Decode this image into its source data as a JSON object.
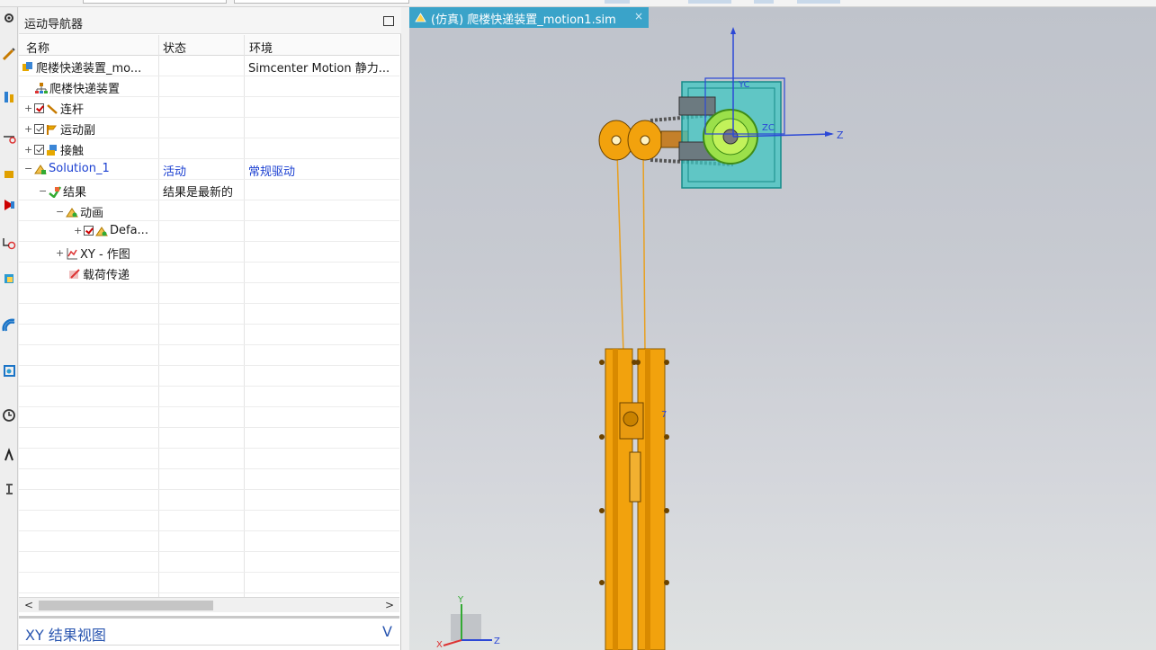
{
  "navigator": {
    "title": "运动导航器",
    "columns": [
      "名称",
      "状态",
      "环境"
    ],
    "rows": [
      {
        "name": "爬楼快递装置_mo...",
        "status": "",
        "env": "Simcenter Motion 静力..."
      },
      {
        "name": "爬楼快递装置",
        "status": "",
        "env": ""
      },
      {
        "name": "连杆",
        "status": "",
        "env": ""
      },
      {
        "name": "运动副",
        "status": "",
        "env": ""
      },
      {
        "name": "接触",
        "status": "",
        "env": ""
      },
      {
        "name": "Solution_1",
        "status": "活动",
        "env": "常规驱动"
      },
      {
        "name": "结果",
        "status": "结果是最新的",
        "env": ""
      },
      {
        "name": "动画",
        "status": "",
        "env": ""
      },
      {
        "name": "Defa...",
        "status": "",
        "env": ""
      },
      {
        "name": "XY - 作图",
        "status": "",
        "env": ""
      },
      {
        "name": "载荷传递",
        "status": "",
        "env": ""
      }
    ],
    "expand_minus": "−",
    "expand_plus": "+"
  },
  "scroll": {
    "left": "<",
    "right": ">"
  },
  "xy_view": {
    "label": "XY 结果视图",
    "chevron": "V"
  },
  "viewport": {
    "tab_label": "(仿真) 爬楼快递装置_motion1.sim",
    "tab_close": "×",
    "axis_labels": {
      "z": "Z",
      "zc": "ZC",
      "yc": "YC",
      "y": "Y",
      "x": "X",
      "seven": "7"
    }
  },
  "colors": {
    "tab": "#3aa3c9",
    "accent_blue": "#1a3fd1",
    "orange": "#f2a20d",
    "teal": "#2fb8b6"
  },
  "icons": [
    "gear-icon",
    "link-icon",
    "joint-icon",
    "contact-icon",
    "solution-icon",
    "result-icon",
    "animation-icon",
    "xy-plot-icon",
    "load-transfer-icon",
    "home-icon"
  ]
}
